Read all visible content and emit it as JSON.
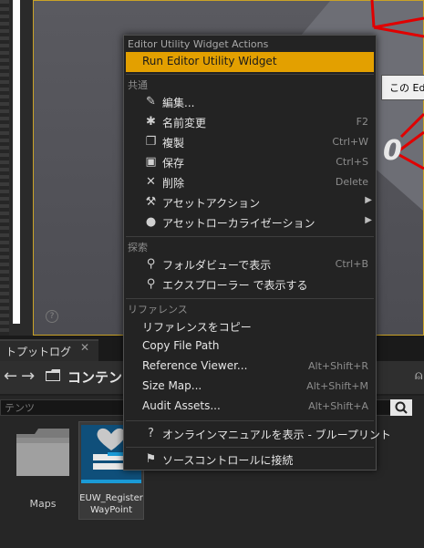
{
  "viewport": {
    "tooltip_text": "この Edi",
    "digit": "0",
    "help_glyph": "?"
  },
  "bottom_panel": {
    "output_tab": "トプットログ",
    "close_glyph": "✕",
    "nav_arrows": "←→",
    "content_label": "コンテンツ",
    "search_placeholder": "テンツ",
    "assets": [
      {
        "label": "Maps"
      },
      {
        "label_line1": "EUW_Register",
        "label_line2": "WayPoint"
      }
    ]
  },
  "context_menu": {
    "header": "Editor Utility Widget Actions",
    "run_label": "Run Editor Utility Widget",
    "sections": {
      "common": "共通",
      "explore": "探索",
      "references": "リファレンス"
    },
    "items": {
      "edit": {
        "label": "編集...",
        "shortcut": "",
        "icon": "pencil-icon"
      },
      "rename": {
        "label": "名前変更",
        "shortcut": "F2",
        "icon": "rename-star-icon"
      },
      "duplicate": {
        "label": "複製",
        "shortcut": "Ctrl+W",
        "icon": "duplicate-icon"
      },
      "save": {
        "label": "保存",
        "shortcut": "Ctrl+S",
        "icon": "save-icon"
      },
      "delete": {
        "label": "削除",
        "shortcut": "Delete",
        "icon": "delete-x-icon"
      },
      "asset_actions": {
        "label": "アセットアクション",
        "icon": "wrench-icon"
      },
      "asset_localization": {
        "label": "アセットローカライゼーション",
        "icon": "globe-icon"
      },
      "show_in_folder": {
        "label": "フォルダビューで表示",
        "shortcut": "Ctrl+B",
        "icon": "magnifier-icon"
      },
      "show_in_explorer": {
        "label": "エクスプローラー で表示する",
        "icon": "magnifier-icon"
      },
      "copy_reference": {
        "label": "リファレンスをコピー"
      },
      "copy_file_path": {
        "label": "Copy File Path"
      },
      "reference_viewer": {
        "label": "Reference Viewer...",
        "shortcut": "Alt+Shift+R"
      },
      "size_map": {
        "label": "Size Map...",
        "shortcut": "Alt+Shift+M"
      },
      "audit_assets": {
        "label": "Audit Assets...",
        "shortcut": "Alt+Shift+A"
      },
      "online_manual": {
        "label": "オンラインマニュアルを表示 - ブループリント",
        "icon": "help-circle-icon"
      },
      "source_control": {
        "label": "ソースコントロールに接続",
        "icon": "source-control-icon"
      }
    }
  }
}
